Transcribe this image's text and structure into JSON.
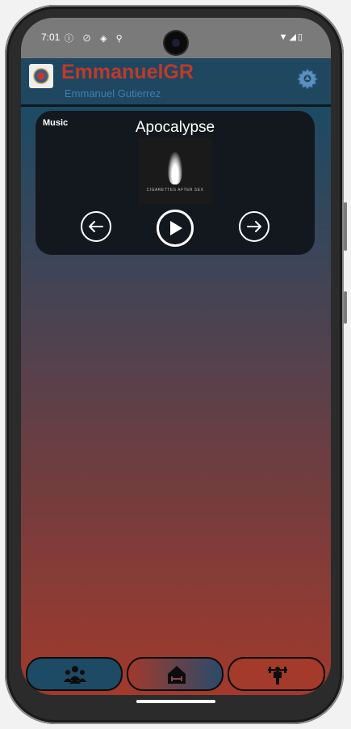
{
  "status_bar": {
    "time": "7:01"
  },
  "header": {
    "title": "EmmanuelGR",
    "subtitle": "Emmanuel Gutierrez"
  },
  "music_card": {
    "label": "Music",
    "song_title": "Apocalypse",
    "album_caption": "CIGARETTES AFTER SEX"
  },
  "icons": {
    "settings": "gear-icon",
    "prev": "arrow-left-icon",
    "play": "play-icon",
    "next": "arrow-right-icon",
    "nav_people": "people-group-icon",
    "nav_home": "home-dumbbell-icon",
    "nav_workout": "weightlifter-icon"
  },
  "colors": {
    "title": "#c0392b",
    "subtitle": "#3a82b0",
    "header_bg": "#1f475f",
    "card_bg": "#13181e",
    "gradient_top": "#1d4a64",
    "gradient_bottom": "#a13a2c"
  }
}
